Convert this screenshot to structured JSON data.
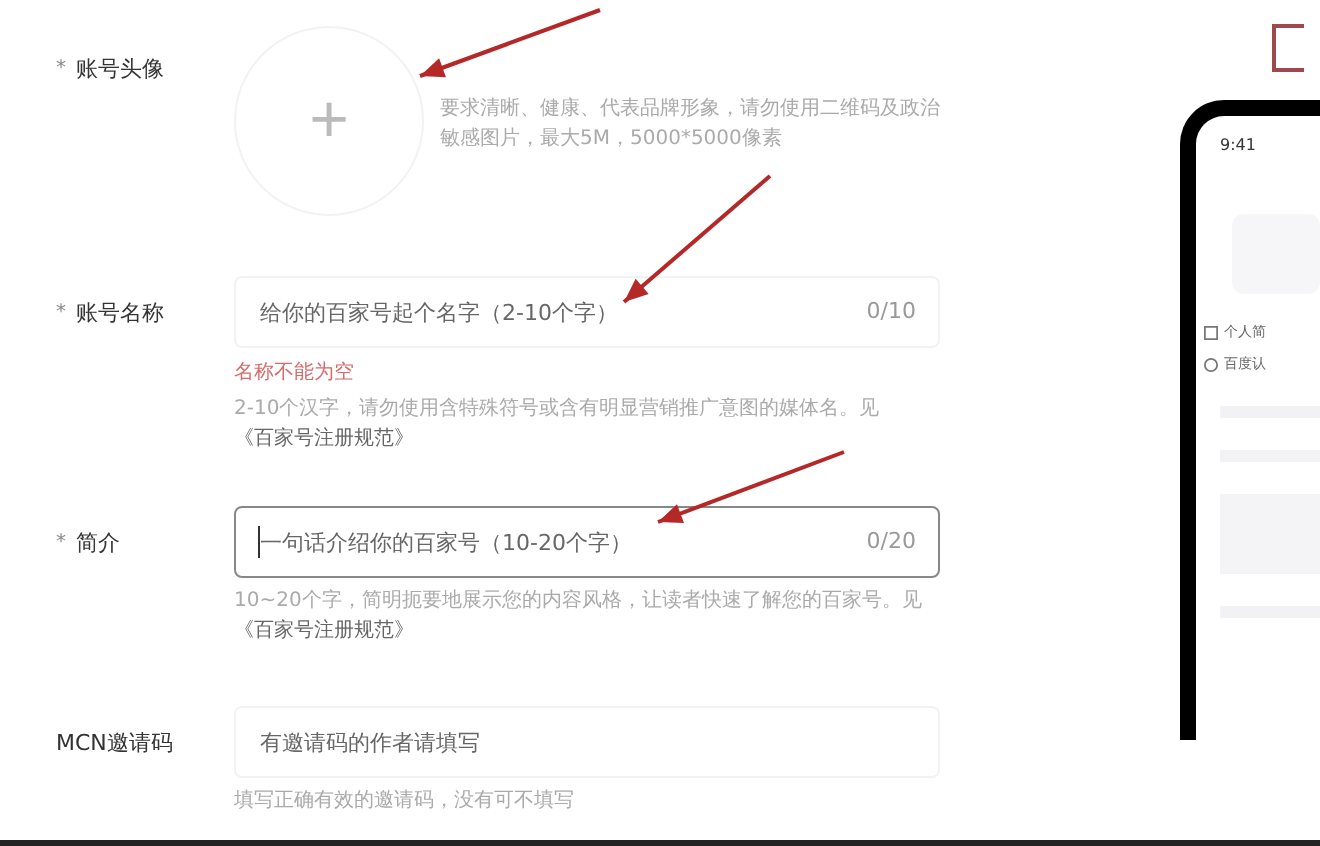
{
  "form": {
    "fields": [
      {
        "kind": "avatar",
        "label": "账号头像",
        "required_mark": "*",
        "hint": "要求清晰、健康、代表品牌形象，请勿使用二维码及政治敏感图片，最大5M，5000*5000像素",
        "plus": "+"
      },
      {
        "kind": "input",
        "label": "账号名称",
        "required_mark": "*",
        "placeholder": "给你的百家号起个名字（2-10个字）",
        "counter": "0/10",
        "focused": false,
        "error": "名称不能为空",
        "hint": "2-10个汉字，请勿使用含特殊符号或含有明显营销推广意图的媒体名。见",
        "hint_link": "《百家号注册规范》"
      },
      {
        "kind": "input",
        "label": "简介",
        "required_mark": "*",
        "placeholder": "一句话介绍你的百家号（10-20个字）",
        "counter": "0/20",
        "focused": true,
        "hint": "10~20个字，简明扼要地展示您的内容风格，让读者快速了解您的百家号。见",
        "hint_link": "《百家号注册规范》"
      },
      {
        "kind": "input",
        "label": "MCN邀请码",
        "placeholder": "有邀请码的作者请填写",
        "focused": false,
        "hint": "填写正确有效的邀请码，没有可不填写"
      }
    ]
  },
  "preview": {
    "time": "9:41",
    "items": [
      {
        "kind": "square",
        "text": "个人简"
      },
      {
        "kind": "circle",
        "text": "百度认"
      }
    ]
  }
}
